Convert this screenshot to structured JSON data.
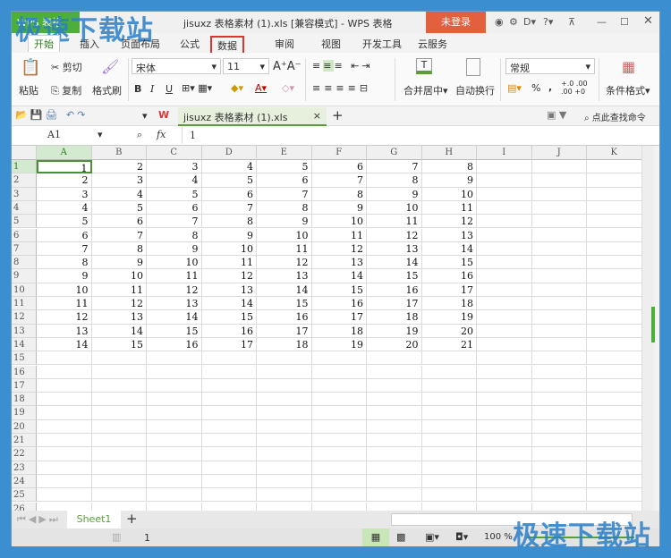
{
  "app": {
    "menu_label": "WPS 表格",
    "title": "jisuxz 表格素材 (1).xls [兼容模式] - WPS 表格",
    "login": "未登录",
    "watermark": "极速下载站"
  },
  "tabs": [
    {
      "label": "开始",
      "active": true
    },
    {
      "label": "插入"
    },
    {
      "label": "页面布局"
    },
    {
      "label": "公式"
    },
    {
      "label": "数据",
      "highlighted": true
    },
    {
      "label": "审阅"
    },
    {
      "label": "视图"
    },
    {
      "label": "开发工具"
    },
    {
      "label": "云服务"
    }
  ],
  "ribbon": {
    "paste": "粘贴",
    "cut": "剪切",
    "copy": "复制",
    "format_painter": "格式刷",
    "font": "宋体",
    "size": "11",
    "bold": "B",
    "italic": "I",
    "underline": "U",
    "merge": "合并居中",
    "wrap": "自动换行",
    "number_format": "常规",
    "percent": "%",
    "comma": ",",
    "cond_format": "条件格式"
  },
  "quick": {
    "doc_tab": "jisuxz 表格素材 (1).xls",
    "close": "×",
    "new_tab": "+",
    "search": "点此查找命令"
  },
  "formula": {
    "name_box": "A1",
    "fx": "fx",
    "value": "1"
  },
  "grid": {
    "columns": [
      "A",
      "B",
      "C",
      "D",
      "E",
      "F",
      "G",
      "H",
      "I",
      "J",
      "K"
    ],
    "row_count": 26,
    "rows": [
      [
        1,
        2,
        3,
        4,
        5,
        6,
        7,
        8
      ],
      [
        2,
        3,
        4,
        5,
        6,
        7,
        8,
        9
      ],
      [
        3,
        4,
        5,
        6,
        7,
        8,
        9,
        10
      ],
      [
        4,
        5,
        6,
        7,
        8,
        9,
        10,
        11
      ],
      [
        5,
        6,
        7,
        8,
        9,
        10,
        11,
        12
      ],
      [
        6,
        7,
        8,
        9,
        10,
        11,
        12,
        13
      ],
      [
        7,
        8,
        9,
        10,
        11,
        12,
        13,
        14
      ],
      [
        8,
        9,
        10,
        11,
        12,
        13,
        14,
        15
      ],
      [
        9,
        10,
        11,
        12,
        13,
        14,
        15,
        16
      ],
      [
        10,
        11,
        12,
        13,
        14,
        15,
        16,
        17
      ],
      [
        11,
        12,
        13,
        14,
        15,
        16,
        17,
        18
      ],
      [
        12,
        13,
        14,
        15,
        16,
        17,
        18,
        19
      ],
      [
        13,
        14,
        15,
        16,
        17,
        18,
        19,
        20
      ],
      [
        14,
        15,
        16,
        17,
        18,
        19,
        20,
        21
      ]
    ],
    "selected": "A1"
  },
  "sheets": {
    "active": "Sheet1",
    "add": "+"
  },
  "status": {
    "page": "1",
    "zoom": "100 %"
  }
}
